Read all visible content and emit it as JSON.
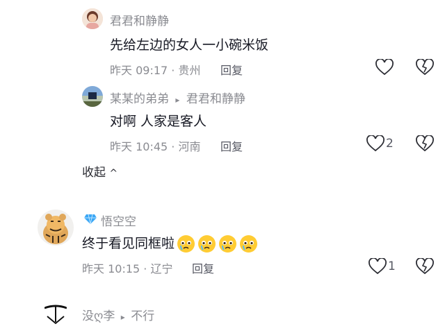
{
  "replies": [
    {
      "author": "君君和静静",
      "text": "先给左边的女人一小碗米饭",
      "time": "昨天 09:17",
      "location": "贵州",
      "reply_label": "回复",
      "like_count": ""
    },
    {
      "author": "某某的弟弟",
      "reply_to_arrow": "▸",
      "reply_to": "君君和静静",
      "text": "对啊 人家是客人",
      "time": "昨天 10:45",
      "location": "河南",
      "reply_label": "回复",
      "like_count": "2"
    }
  ],
  "collapse_label": "收起",
  "collapse_arrow": "^",
  "comment": {
    "author": "悟空空",
    "text": "终于看见同框啦",
    "emoji_count": 4,
    "time": "昨天 10:15",
    "location": "辽宁",
    "reply_label": "回复",
    "like_count": "1"
  },
  "next_comment": {
    "author": "没ღ李",
    "reply_to": "不行"
  },
  "separator": "·",
  "colors": {
    "text_primary": "#161823",
    "text_secondary": "#8a8b91",
    "diamond_badge": "#3aa7f5",
    "emoji_face": "#ffcc33"
  }
}
